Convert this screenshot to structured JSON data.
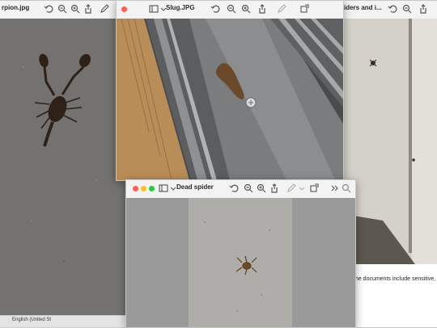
{
  "windows": {
    "scorpion": {
      "title": "rpion.jpg",
      "footer": "English (United St"
    },
    "slug": {
      "title": "Slug.JPG"
    },
    "spiders": {
      "title": "iders and i...",
      "partial_text": "the documents include sensitive,"
    },
    "dead_spider": {
      "title": "Dead spider"
    }
  },
  "colors": {
    "close": "#fe5f57",
    "minimize": "#febc2e",
    "zoom": "#28c840"
  }
}
